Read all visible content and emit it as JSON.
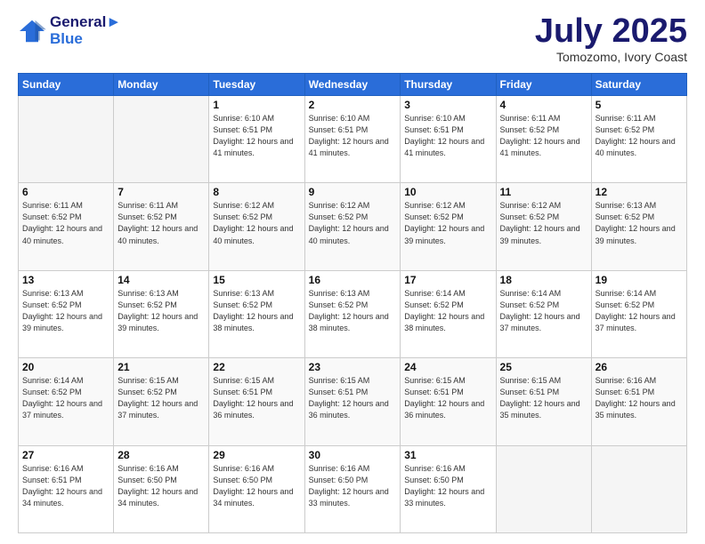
{
  "header": {
    "logo_line1": "General",
    "logo_line2": "Blue",
    "month": "July 2025",
    "location": "Tomozomo, Ivory Coast"
  },
  "days_of_week": [
    "Sunday",
    "Monday",
    "Tuesday",
    "Wednesday",
    "Thursday",
    "Friday",
    "Saturday"
  ],
  "weeks": [
    [
      {
        "day": "",
        "info": ""
      },
      {
        "day": "",
        "info": ""
      },
      {
        "day": "1",
        "info": "Sunrise: 6:10 AM\nSunset: 6:51 PM\nDaylight: 12 hours and 41 minutes."
      },
      {
        "day": "2",
        "info": "Sunrise: 6:10 AM\nSunset: 6:51 PM\nDaylight: 12 hours and 41 minutes."
      },
      {
        "day": "3",
        "info": "Sunrise: 6:10 AM\nSunset: 6:51 PM\nDaylight: 12 hours and 41 minutes."
      },
      {
        "day": "4",
        "info": "Sunrise: 6:11 AM\nSunset: 6:52 PM\nDaylight: 12 hours and 41 minutes."
      },
      {
        "day": "5",
        "info": "Sunrise: 6:11 AM\nSunset: 6:52 PM\nDaylight: 12 hours and 40 minutes."
      }
    ],
    [
      {
        "day": "6",
        "info": "Sunrise: 6:11 AM\nSunset: 6:52 PM\nDaylight: 12 hours and 40 minutes."
      },
      {
        "day": "7",
        "info": "Sunrise: 6:11 AM\nSunset: 6:52 PM\nDaylight: 12 hours and 40 minutes."
      },
      {
        "day": "8",
        "info": "Sunrise: 6:12 AM\nSunset: 6:52 PM\nDaylight: 12 hours and 40 minutes."
      },
      {
        "day": "9",
        "info": "Sunrise: 6:12 AM\nSunset: 6:52 PM\nDaylight: 12 hours and 40 minutes."
      },
      {
        "day": "10",
        "info": "Sunrise: 6:12 AM\nSunset: 6:52 PM\nDaylight: 12 hours and 39 minutes."
      },
      {
        "day": "11",
        "info": "Sunrise: 6:12 AM\nSunset: 6:52 PM\nDaylight: 12 hours and 39 minutes."
      },
      {
        "day": "12",
        "info": "Sunrise: 6:13 AM\nSunset: 6:52 PM\nDaylight: 12 hours and 39 minutes."
      }
    ],
    [
      {
        "day": "13",
        "info": "Sunrise: 6:13 AM\nSunset: 6:52 PM\nDaylight: 12 hours and 39 minutes."
      },
      {
        "day": "14",
        "info": "Sunrise: 6:13 AM\nSunset: 6:52 PM\nDaylight: 12 hours and 39 minutes."
      },
      {
        "day": "15",
        "info": "Sunrise: 6:13 AM\nSunset: 6:52 PM\nDaylight: 12 hours and 38 minutes."
      },
      {
        "day": "16",
        "info": "Sunrise: 6:13 AM\nSunset: 6:52 PM\nDaylight: 12 hours and 38 minutes."
      },
      {
        "day": "17",
        "info": "Sunrise: 6:14 AM\nSunset: 6:52 PM\nDaylight: 12 hours and 38 minutes."
      },
      {
        "day": "18",
        "info": "Sunrise: 6:14 AM\nSunset: 6:52 PM\nDaylight: 12 hours and 37 minutes."
      },
      {
        "day": "19",
        "info": "Sunrise: 6:14 AM\nSunset: 6:52 PM\nDaylight: 12 hours and 37 minutes."
      }
    ],
    [
      {
        "day": "20",
        "info": "Sunrise: 6:14 AM\nSunset: 6:52 PM\nDaylight: 12 hours and 37 minutes."
      },
      {
        "day": "21",
        "info": "Sunrise: 6:15 AM\nSunset: 6:52 PM\nDaylight: 12 hours and 37 minutes."
      },
      {
        "day": "22",
        "info": "Sunrise: 6:15 AM\nSunset: 6:51 PM\nDaylight: 12 hours and 36 minutes."
      },
      {
        "day": "23",
        "info": "Sunrise: 6:15 AM\nSunset: 6:51 PM\nDaylight: 12 hours and 36 minutes."
      },
      {
        "day": "24",
        "info": "Sunrise: 6:15 AM\nSunset: 6:51 PM\nDaylight: 12 hours and 36 minutes."
      },
      {
        "day": "25",
        "info": "Sunrise: 6:15 AM\nSunset: 6:51 PM\nDaylight: 12 hours and 35 minutes."
      },
      {
        "day": "26",
        "info": "Sunrise: 6:16 AM\nSunset: 6:51 PM\nDaylight: 12 hours and 35 minutes."
      }
    ],
    [
      {
        "day": "27",
        "info": "Sunrise: 6:16 AM\nSunset: 6:51 PM\nDaylight: 12 hours and 34 minutes."
      },
      {
        "day": "28",
        "info": "Sunrise: 6:16 AM\nSunset: 6:50 PM\nDaylight: 12 hours and 34 minutes."
      },
      {
        "day": "29",
        "info": "Sunrise: 6:16 AM\nSunset: 6:50 PM\nDaylight: 12 hours and 34 minutes."
      },
      {
        "day": "30",
        "info": "Sunrise: 6:16 AM\nSunset: 6:50 PM\nDaylight: 12 hours and 33 minutes."
      },
      {
        "day": "31",
        "info": "Sunrise: 6:16 AM\nSunset: 6:50 PM\nDaylight: 12 hours and 33 minutes."
      },
      {
        "day": "",
        "info": ""
      },
      {
        "day": "",
        "info": ""
      }
    ]
  ]
}
